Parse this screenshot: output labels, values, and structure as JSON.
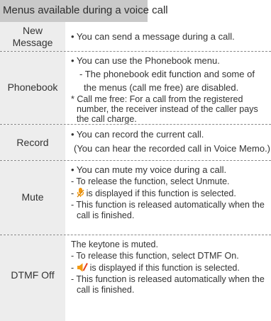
{
  "header": {
    "title": "Menus available during a voice call"
  },
  "rows": [
    {
      "label": [
        "New",
        "Message"
      ],
      "lines": [
        "• You can send a message during a call."
      ]
    },
    {
      "label": [
        "Phonebook"
      ],
      "lines": [
        "• You can use the Phonebook menu.",
        "- The phonebook edit function and some of",
        "the menus (call me free) are disabled.",
        "* Call me free: For a call from the registered",
        "number, the receiver instead of the caller pays",
        "the call charge."
      ]
    },
    {
      "label": [
        "Record"
      ],
      "lines": [
        "• You can record the current call.",
        "(You can hear the recorded call in Voice Memo.)"
      ]
    },
    {
      "label": [
        "Mute"
      ],
      "lines": [
        "• You can mute my voice during a call.",
        "- To release the function, select Unmute.",
        "- ",
        "is displayed if this function is selected.",
        "- This function is released automatically when the",
        "call is finished."
      ],
      "icon": "muted-microphone-icon"
    },
    {
      "label": [
        "DTMF Off"
      ],
      "lines": [
        "The keytone is muted.",
        "- To release this function, select DTMF On.",
        "- ",
        "is displayed if this function is selected.",
        "- This function is released automatically when the",
        "call is finished."
      ],
      "icon": "muted-speaker-icon"
    }
  ],
  "colors": {
    "header_bg": "#c9c9c9",
    "label_bg": "#ededed",
    "icon_orange": "#f39a12",
    "text": "#333333"
  }
}
